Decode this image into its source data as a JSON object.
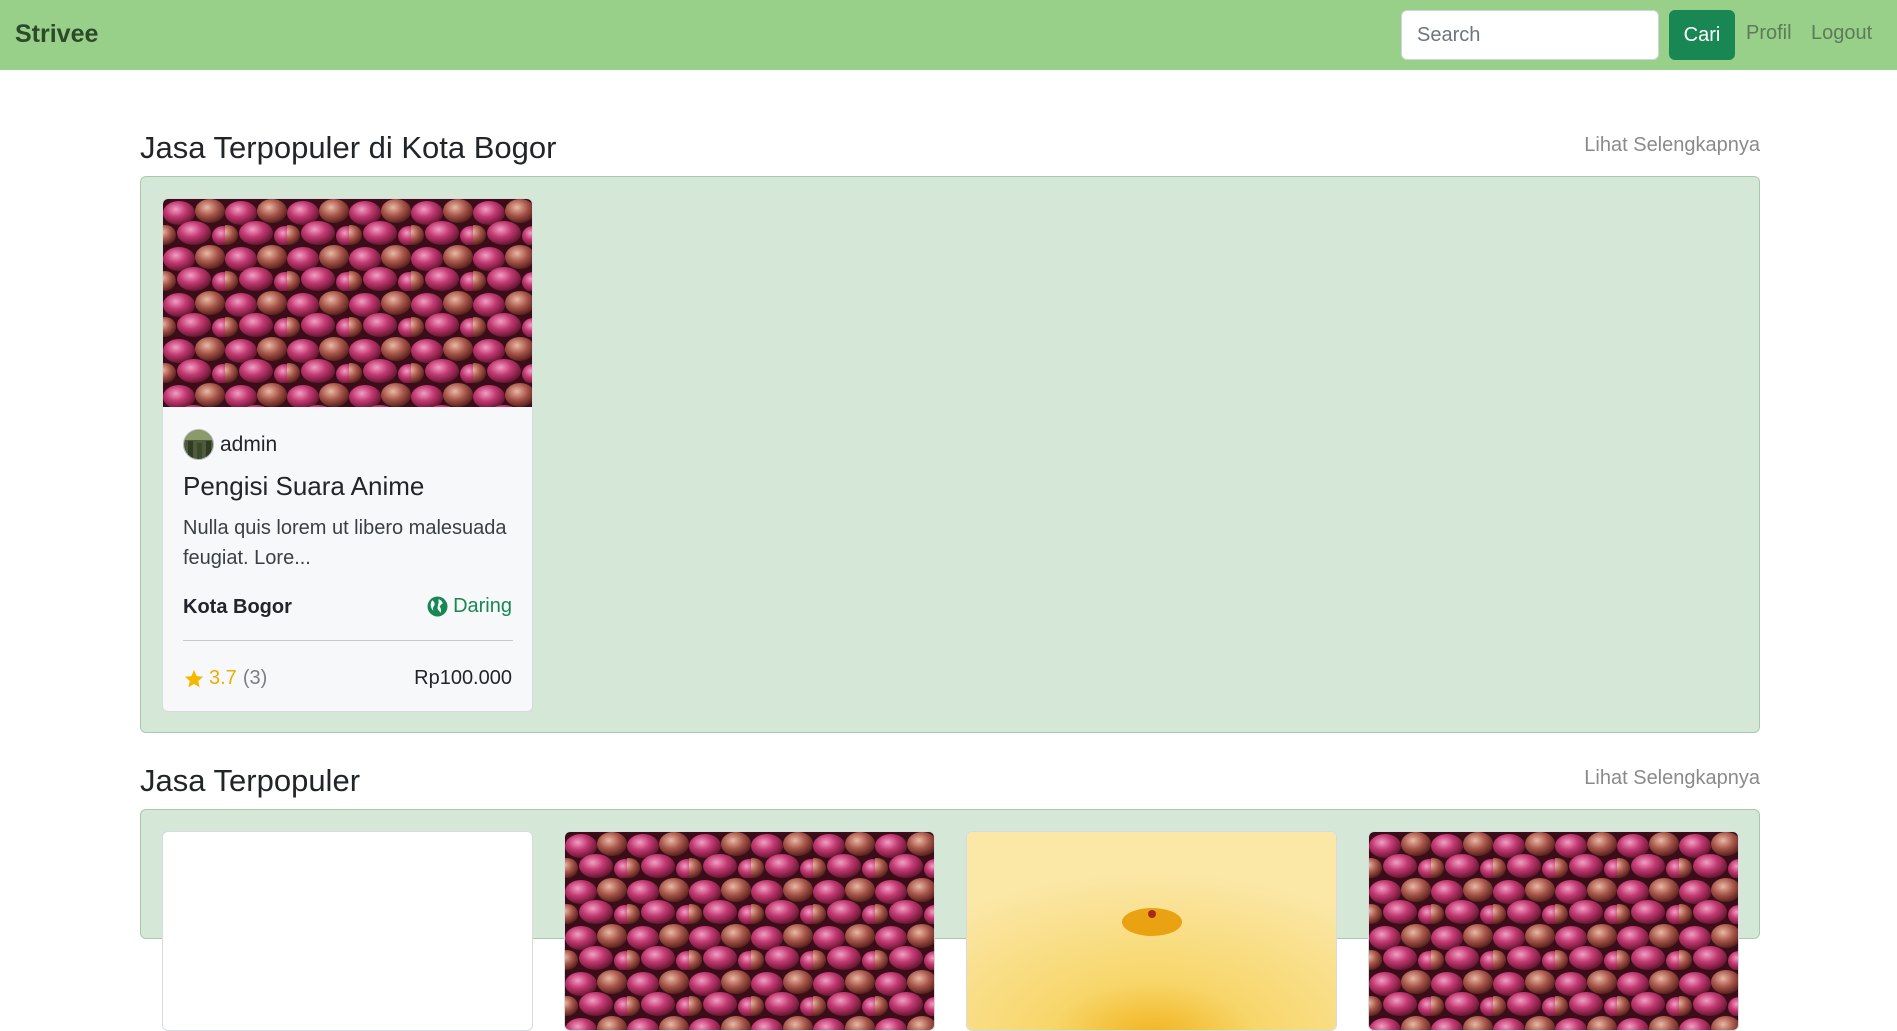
{
  "navbar": {
    "brand": "Strivee",
    "search_placeholder": "Search",
    "search_button": "Cari",
    "links": [
      "Profil",
      "Logout"
    ]
  },
  "sections": [
    {
      "title": "Jasa Terpopuler di Kota Bogor",
      "see_more": "Lihat Selengkapnya",
      "cards": [
        {
          "seller": "admin",
          "title": "Pengisi Suara Anime",
          "description": "Nulla quis lorem ut libero malesuada feugiat. Lore...",
          "location": "Kota Bogor",
          "mode": "Daring",
          "mode_icon": "globe-icon",
          "rating": "3.7",
          "rating_count": "(3)",
          "price": "Rp100.000",
          "image": "shallots-photo"
        }
      ]
    },
    {
      "title": "Jasa Terpopuler",
      "see_more": "Lihat Selengkapnya",
      "cards_images": [
        "blank",
        "shallots-photo",
        "yellow-flower-photo",
        "shallots-photo"
      ]
    }
  ],
  "colors": {
    "navbar": "#98d08a",
    "primary_button": "#198754",
    "section_background": "#d5e8d8",
    "rating_star": "#f5b800"
  }
}
